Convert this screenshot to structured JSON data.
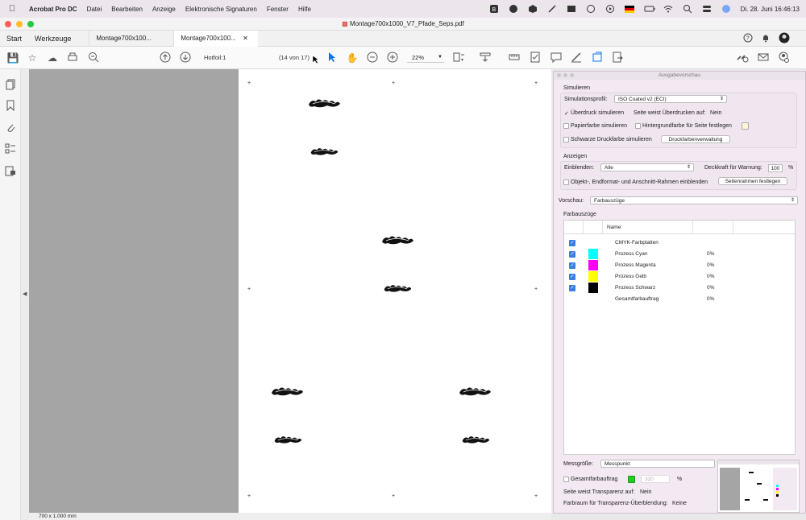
{
  "menubar": {
    "app": "Acrobat Pro DC",
    "items": [
      "Datei",
      "Bearbeiten",
      "Anzeige",
      "Elektronische Signaturen",
      "Fenster",
      "Hilfe"
    ],
    "clock": "Di. 28. Juni  16:46:13"
  },
  "window": {
    "title": "Montage700x1000_V7_Pfade_Seps.pdf"
  },
  "tabs": {
    "start": "Start",
    "tools": "Werkzeuge",
    "doc1": "Montage700x100...",
    "doc2": "Montage700x100..."
  },
  "toolbar": {
    "page_label": "Hotfoil:1",
    "page_count": "(14 von 17)",
    "zoom": "22%"
  },
  "statusbar": {
    "size": "700 x 1.000 mm"
  },
  "panel": {
    "title": "Ausgabevorschau",
    "simulieren": "Simulieren",
    "simulationsprofil_label": "Simulationsprofil:",
    "simulationsprofil_value": "ISO Coated v2 (ECI)",
    "ueberdruck_label": "Überdruck simulieren",
    "ueberdruck_check": "✓",
    "seite_ueberdrucken_label": "Seite weist Überdrucken auf:",
    "seite_ueberdrucken_value": "Nein",
    "papierfarbe_label": "Papierfarbe simulieren",
    "hintergrund_label": "Hintergrundfarbe für Seite festlegen",
    "schwarze_label": "Schwarze Druckfarbe simulieren",
    "druckfarben_button": "Druckfarbenverwaltung",
    "anzeigen": "Anzeigen",
    "einblenden_label": "Einblenden:",
    "einblenden_value": "Alle",
    "deckkraft_label": "Deckkraft für Warnung:",
    "deckkraft_value": "100",
    "deckkraft_unit": "%",
    "rahmen_label": "Objekt-, Endformat- und Anschnitt-Rahmen einblenden",
    "seitenrahmen_button": "Seitenrahmen festlegen",
    "vorschau_label": "Vorschau:",
    "vorschau_value": "Farbauszüge",
    "farbauszuege": "Farbauszüge",
    "name_header": "Name",
    "separations": [
      {
        "name": "CMYK-Farbplatten",
        "percent": "",
        "checked": true,
        "color": ""
      },
      {
        "name": "Prozess Cyan",
        "percent": "0%",
        "checked": true,
        "color": "#00ffff"
      },
      {
        "name": "Prozess Magenta",
        "percent": "0%",
        "checked": true,
        "color": "#ff00ff"
      },
      {
        "name": "Prozess Gelb",
        "percent": "0%",
        "checked": true,
        "color": "#ffff00"
      },
      {
        "name": "Prozess Schwarz",
        "percent": "0%",
        "checked": true,
        "color": "#000000"
      },
      {
        "name": "Gesamtfarbauftrag",
        "percent": "0%",
        "checked": false,
        "color": ""
      }
    ],
    "messgroesse_label": "Messgröße:",
    "messgroesse_value": "Messpunkt",
    "gesamt_label": "Gesamtfarbauftrag",
    "gesamt_value": "320",
    "gesamt_unit": "%",
    "transparenz_label": "Seite weist Transparenz auf:",
    "transparenz_value": "Nein",
    "farbraum_label": "Farbraum für Transparenz-Überblendung:",
    "farbraum_value": "Keine"
  },
  "colors": {
    "accent": "#1473e6",
    "panel_bg": "#f2e9f2",
    "docarea_bg": "#a5a5a5"
  }
}
